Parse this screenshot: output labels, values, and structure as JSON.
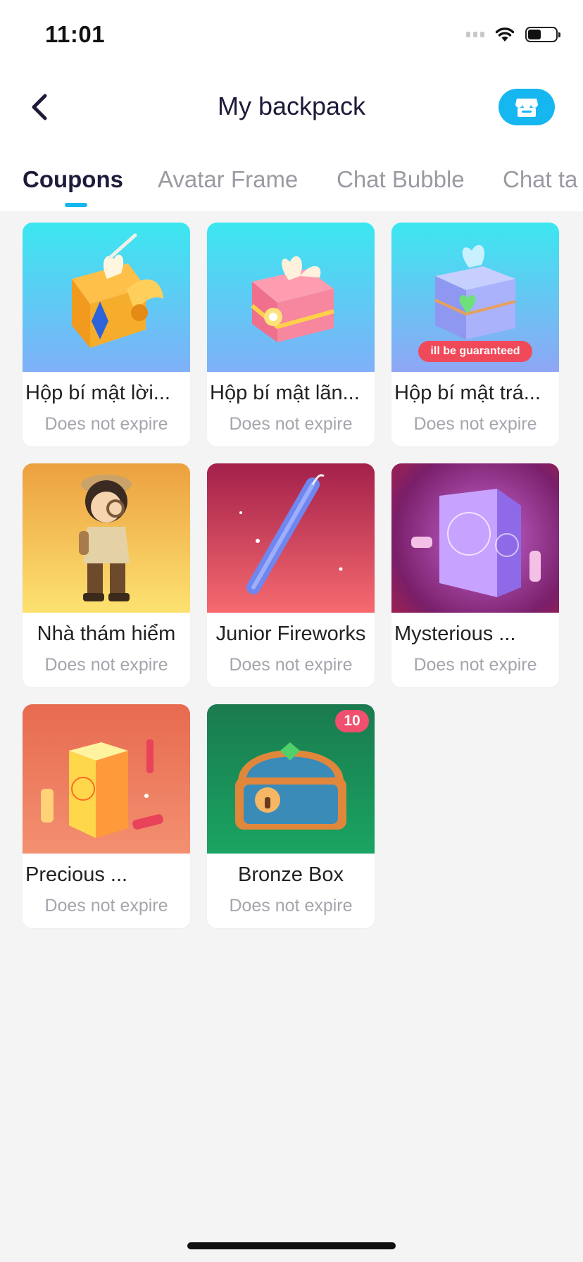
{
  "status_bar": {
    "time": "11:01"
  },
  "header": {
    "title": "My backpack",
    "back_icon": "chevron-left-icon",
    "store_icon": "store-icon",
    "accent": "#16b7f0"
  },
  "tabs": [
    {
      "label": "Coupons",
      "active": true
    },
    {
      "label": "Avatar Frame",
      "active": false
    },
    {
      "label": "Chat Bubble",
      "active": false
    },
    {
      "label": "Chat ta",
      "active": false
    }
  ],
  "items": [
    {
      "name": "Hộp bí mật lời...",
      "subtitle": "Does not expire",
      "icon": "orange-gift-box-icon"
    },
    {
      "name": "Hộp bí mật lãn...",
      "subtitle": "Does not expire",
      "icon": "pink-gift-box-icon"
    },
    {
      "name": "Hộp bí mật trá...",
      "subtitle": "Does not expire",
      "icon": "blue-gift-box-icon",
      "badge": "ill be guaranteed"
    },
    {
      "name": "Nhà thám hiểm",
      "subtitle": "Does not expire",
      "icon": "explorer-character-icon"
    },
    {
      "name": "Junior Fireworks",
      "subtitle": "Does not expire",
      "icon": "firework-stick-icon"
    },
    {
      "name": "Mysterious ...",
      "subtitle": "Does not expire",
      "icon": "purple-firework-box-icon"
    },
    {
      "name": "Precious ...",
      "subtitle": "Does not expire",
      "icon": "orange-firework-box-icon"
    },
    {
      "name": "Bronze Box",
      "subtitle": "Does not expire",
      "icon": "bronze-chest-icon",
      "count": "10"
    }
  ]
}
